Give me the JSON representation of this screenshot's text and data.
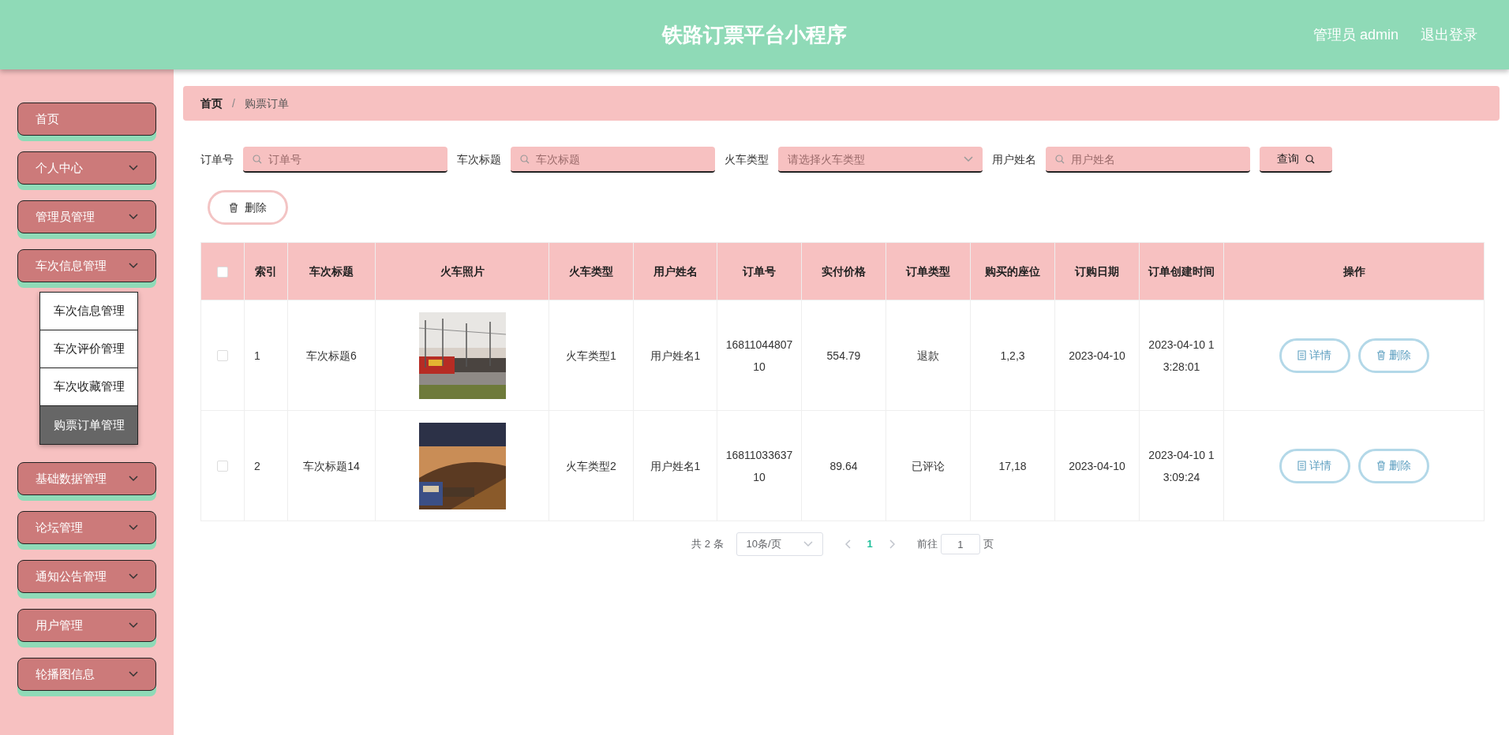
{
  "header": {
    "title": "铁路订票平台小程序",
    "user": "管理员 admin",
    "logout": "退出登录"
  },
  "sidebar": {
    "items": [
      {
        "label": "首页",
        "has_arrow": false
      },
      {
        "label": "个人中心",
        "has_arrow": true
      },
      {
        "label": "管理员管理",
        "has_arrow": true
      },
      {
        "label": "车次信息管理",
        "has_arrow": true,
        "children": [
          {
            "label": "车次信息管理",
            "selected": false
          },
          {
            "label": "车次评价管理",
            "selected": false
          },
          {
            "label": "车次收藏管理",
            "selected": false
          },
          {
            "label": "购票订单管理",
            "selected": true
          }
        ]
      },
      {
        "label": "基础数据管理",
        "has_arrow": true
      },
      {
        "label": "论坛管理",
        "has_arrow": true
      },
      {
        "label": "通知公告管理",
        "has_arrow": true
      },
      {
        "label": "用户管理",
        "has_arrow": true
      },
      {
        "label": "轮播图信息",
        "has_arrow": true
      }
    ]
  },
  "breadcrumb": {
    "items": [
      "首页",
      "购票订单"
    ],
    "separator": "/"
  },
  "filters": [
    {
      "kind": "input",
      "label": "订单号",
      "placeholder": "订单号"
    },
    {
      "kind": "input",
      "label": "车次标题",
      "placeholder": "车次标题"
    },
    {
      "kind": "select",
      "label": "火车类型",
      "placeholder": "请选择火车类型"
    },
    {
      "kind": "input",
      "label": "用户姓名",
      "placeholder": "用户姓名"
    }
  ],
  "search_button": "查询",
  "delete_button": "删除",
  "table": {
    "all_checked": false,
    "columns": [
      "索引",
      "车次标题",
      "火车照片",
      "火车类型",
      "用户姓名",
      "订单号",
      "实付价格",
      "订单类型",
      "购买的座位",
      "订购日期",
      "订单创建时间",
      "操作"
    ],
    "rows": [
      {
        "checked": false,
        "cells": [
          "1",
          "车次标题6",
          "",
          "火车类型1",
          "用户姓名1",
          "1681104480710",
          "554.79",
          "退款",
          "1,2,3",
          "2023-04-10",
          "2023-04-10 13:28:01"
        ],
        "actions": [
          "详情",
          "删除"
        ]
      },
      {
        "checked": false,
        "cells": [
          "2",
          "车次标题14",
          "",
          "火车类型2",
          "用户姓名1",
          "1681103363710",
          "89.64",
          "已评论",
          "17,18",
          "2023-04-10",
          "2023-04-10 13:09:24"
        ],
        "actions": [
          "详情",
          "删除"
        ]
      }
    ]
  },
  "pagination": {
    "total": "共 2 条",
    "page_size": "10条/页",
    "pages": [
      {
        "label": "1",
        "selected": true
      }
    ],
    "goto_label": "前往",
    "goto_value": "1",
    "goto_suffix": "页"
  }
}
